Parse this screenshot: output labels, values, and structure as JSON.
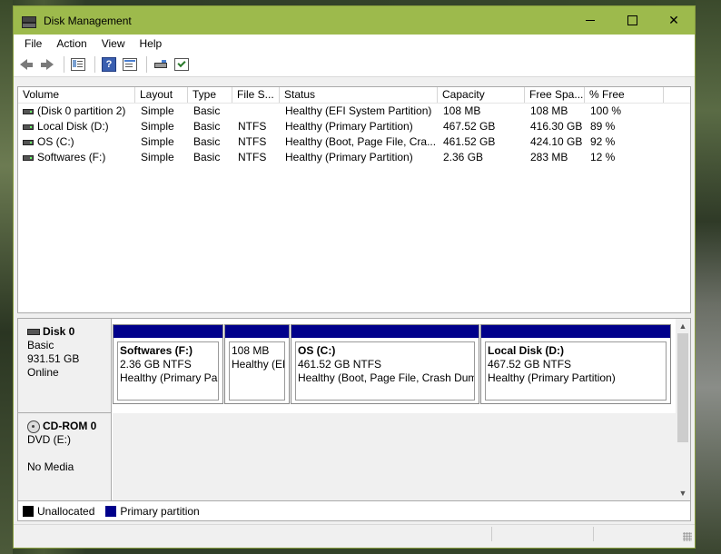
{
  "window": {
    "title": "Disk Management"
  },
  "menu": [
    "File",
    "Action",
    "View",
    "Help"
  ],
  "toolbar": {
    "buttons": [
      "back-icon",
      "forward-icon",
      "show-panel-icon",
      "help-icon",
      "properties-icon",
      "disk-icon",
      "check-icon"
    ]
  },
  "volumes": {
    "columns": [
      "Volume",
      "Layout",
      "Type",
      "File S...",
      "Status",
      "Capacity",
      "Free Spa...",
      "% Free"
    ],
    "rows": [
      {
        "volume": "(Disk 0 partition 2)",
        "layout": "Simple",
        "type": "Basic",
        "fs": "",
        "status": "Healthy (EFI System Partition)",
        "capacity": "108 MB",
        "free": "108 MB",
        "pct": "100 %"
      },
      {
        "volume": "Local Disk (D:)",
        "layout": "Simple",
        "type": "Basic",
        "fs": "NTFS",
        "status": "Healthy (Primary Partition)",
        "capacity": "467.52 GB",
        "free": "416.30 GB",
        "pct": "89 %"
      },
      {
        "volume": "OS (C:)",
        "layout": "Simple",
        "type": "Basic",
        "fs": "NTFS",
        "status": "Healthy (Boot, Page File, Cra...",
        "capacity": "461.52 GB",
        "free": "424.10 GB",
        "pct": "92 %"
      },
      {
        "volume": "Softwares (F:)",
        "layout": "Simple",
        "type": "Basic",
        "fs": "NTFS",
        "status": "Healthy (Primary Partition)",
        "capacity": "2.36 GB",
        "free": "283 MB",
        "pct": "12 %"
      }
    ]
  },
  "disks": {
    "disk0": {
      "title": "Disk 0",
      "type": "Basic",
      "size": "931.51 GB",
      "state": "Online",
      "partitions": [
        {
          "name": "Softwares  (F:)",
          "size": "2.36 GB NTFS",
          "status": "Healthy (Primary Par"
        },
        {
          "name": "",
          "size": "108 MB",
          "status": "Healthy (EF"
        },
        {
          "name": "OS  (C:)",
          "size": "461.52 GB NTFS",
          "status": "Healthy (Boot, Page File, Crash Dum"
        },
        {
          "name": "Local Disk  (D:)",
          "size": "467.52 GB NTFS",
          "status": "Healthy (Primary Partition)"
        }
      ]
    },
    "cdrom0": {
      "title": "CD-ROM 0",
      "type": "DVD (E:)",
      "media": "No Media"
    }
  },
  "legend": {
    "unallocated": "Unallocated",
    "primary": "Primary partition",
    "unallocated_color": "#000000",
    "primary_color": "#00008b"
  },
  "colors": {
    "titlebar": "#9dba4c",
    "partition_bar": "#00008b"
  }
}
